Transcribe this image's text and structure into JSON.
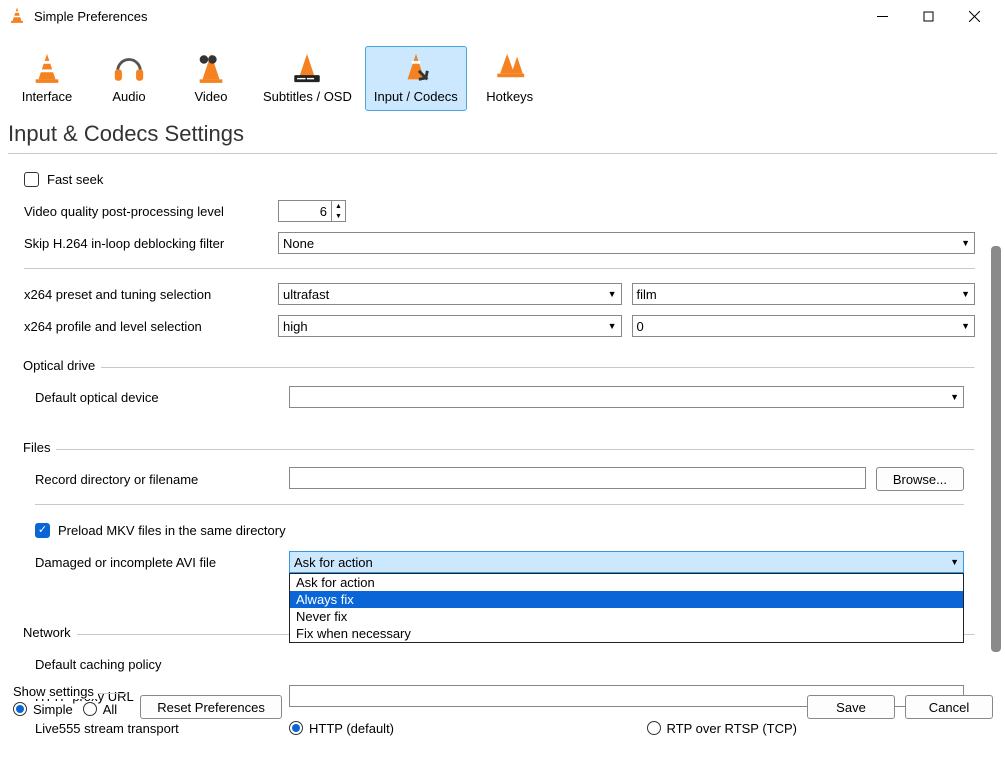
{
  "window": {
    "title": "Simple Preferences"
  },
  "tabs": {
    "interface": "Interface",
    "audio": "Audio",
    "video": "Video",
    "subtitles_osd": "Subtitles / OSD",
    "input_codecs": "Input / Codecs",
    "hotkeys": "Hotkeys"
  },
  "page_heading": "Input & Codecs Settings",
  "codecs": {
    "fast_seek": "Fast seek",
    "quality_label": "Video quality post-processing level",
    "quality_value": "6",
    "skip_deblock_label": "Skip H.264 in-loop deblocking filter",
    "skip_deblock_value": "None",
    "x264_preset_label": "x264 preset and tuning selection",
    "x264_preset_value": "ultrafast",
    "x264_tune_value": "film",
    "x264_profile_label": "x264 profile and level selection",
    "x264_profile_value": "high",
    "x264_level_value": "0"
  },
  "optical": {
    "group": "Optical drive",
    "default_label": "Default optical device",
    "default_value": ""
  },
  "files": {
    "group": "Files",
    "record_label": "Record directory or filename",
    "record_value": "",
    "browse": "Browse...",
    "preload_mkv": "Preload MKV files in the same directory",
    "damaged_avi_label": "Damaged or incomplete AVI file",
    "damaged_avi_value": "Ask for action",
    "damaged_avi_options": {
      "ask": "Ask for action",
      "always": "Always fix",
      "never": "Never fix",
      "when": "Fix when necessary"
    }
  },
  "network": {
    "group": "Network",
    "caching_label": "Default caching policy",
    "proxy_label": "HTTP proxy URL",
    "proxy_value": "",
    "live555_label": "Live555 stream transport",
    "live555_http": "HTTP (default)",
    "live555_rtp": "RTP over RTSP (TCP)"
  },
  "footer": {
    "show_settings": "Show settings",
    "simple": "Simple",
    "all": "All",
    "reset": "Reset Preferences",
    "save": "Save",
    "cancel": "Cancel"
  }
}
